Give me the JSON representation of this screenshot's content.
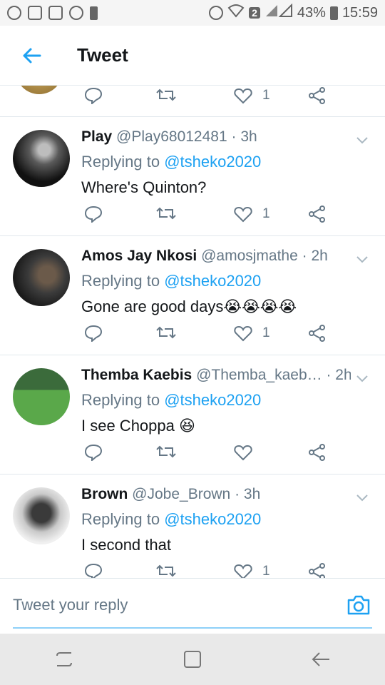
{
  "status_bar": {
    "battery": "43%",
    "time": "15:59",
    "sim_badge": "2"
  },
  "header": {
    "title": "Tweet"
  },
  "partial_tweet": {
    "likes": "1"
  },
  "tweets": [
    {
      "name": "Play",
      "handle": "@Play68012481",
      "time": "· 3h",
      "replying_prefix": "Replying to ",
      "replying_to": "@tsheko2020",
      "text": "Where's Quinton?",
      "likes": "1"
    },
    {
      "name": "Amos Jay Nkosi",
      "handle": "@amosjmathe",
      "time": "· 2h",
      "replying_prefix": "Replying to ",
      "replying_to": "@tsheko2020",
      "text": "Gone are good days😭😭😭😭",
      "likes": "1"
    },
    {
      "name": "Themba Kaebis",
      "handle": "@Themba_kaeb…",
      "time": "· 2h",
      "replying_prefix": "Replying to ",
      "replying_to": "@tsheko2020",
      "text": "I see Choppa 😆",
      "likes": ""
    },
    {
      "name": "Brown",
      "handle": "@Jobe_Brown",
      "time": "· 3h",
      "replying_prefix": "Replying to ",
      "replying_to": "@tsheko2020",
      "text": "I second that",
      "likes": "1"
    }
  ],
  "composer": {
    "placeholder": "Tweet your reply"
  },
  "colors": {
    "accent": "#1da1f2",
    "muted": "#657786",
    "divider": "#e1e8ed"
  },
  "icons": {
    "back": "arrow-left-icon",
    "reply": "comment-icon",
    "retweet": "retweet-icon",
    "like": "heart-icon",
    "share": "share-icon",
    "camera": "camera-icon",
    "chevron": "chevron-down-icon"
  }
}
